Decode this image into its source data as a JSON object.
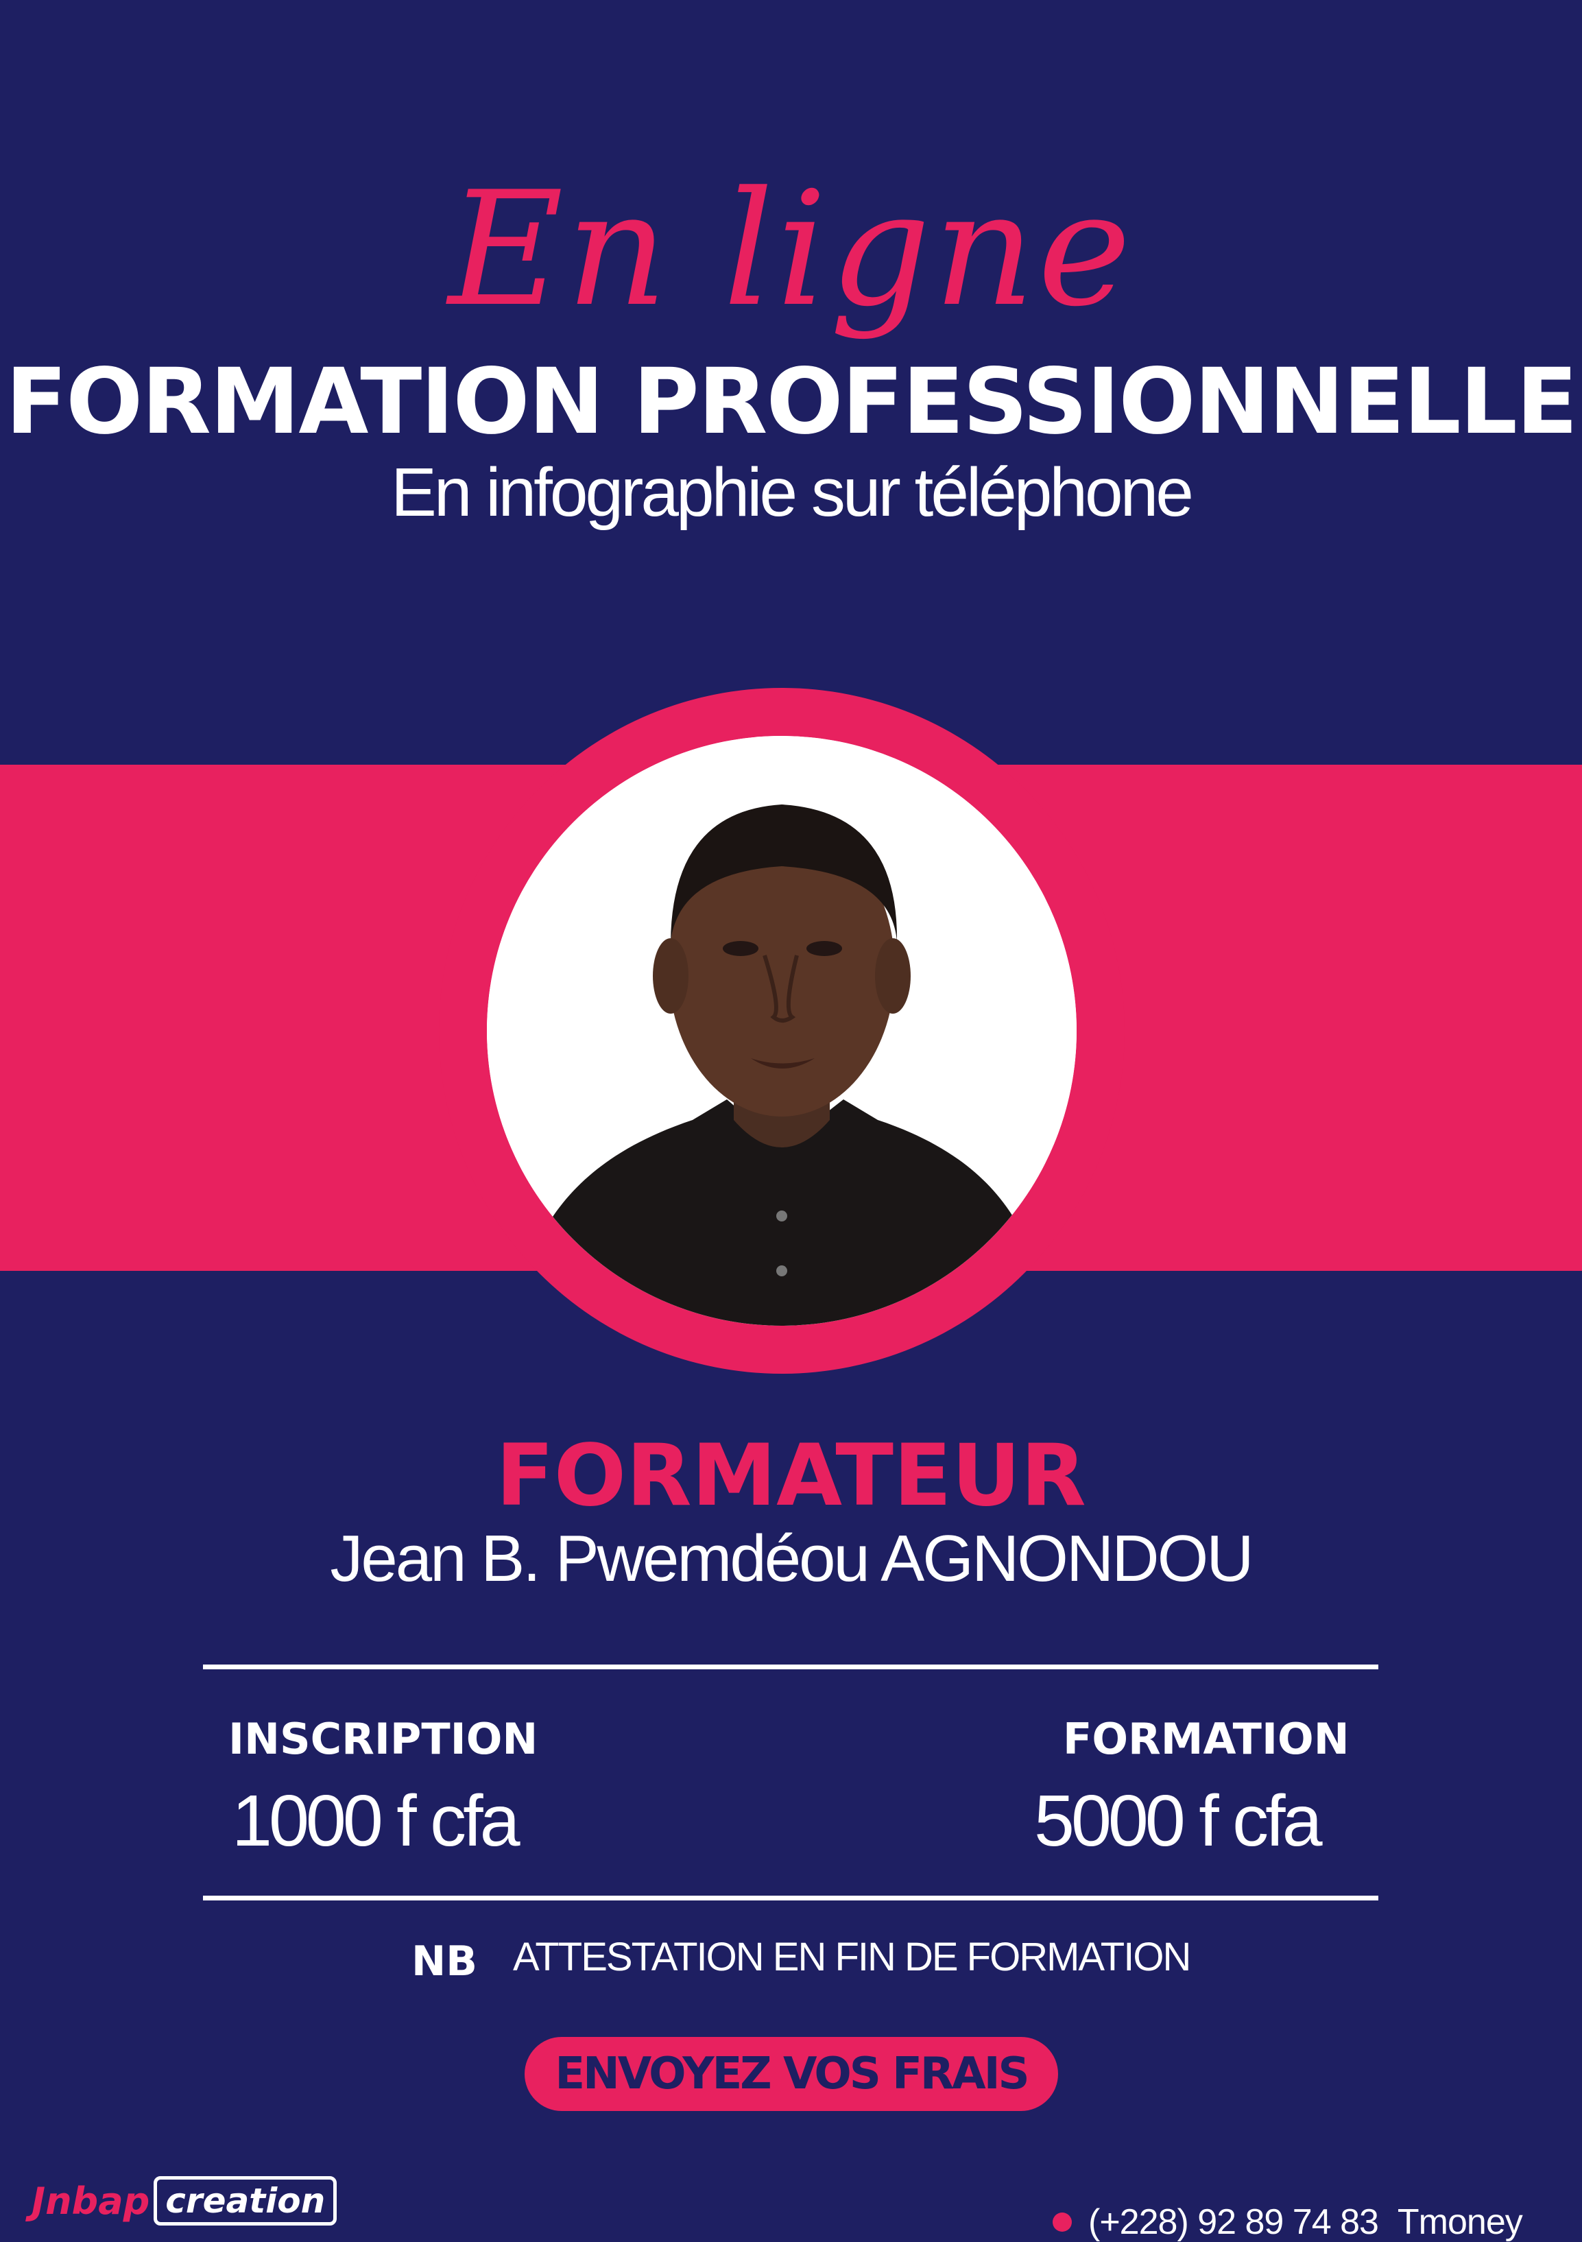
{
  "header": {
    "script_title": "En ligne",
    "main_title": "FORMATION PROFESSIONNELLE",
    "subtitle": "En infographie sur téléphone"
  },
  "trainer": {
    "role": "FORMATEUR",
    "name": "Jean B. Pwemdéou AGNONDOU"
  },
  "pricing": {
    "inscription": {
      "label": "INSCRIPTION",
      "value": "1000 f cfa"
    },
    "formation": {
      "label": "FORMATION",
      "value": "5000 f cfa"
    }
  },
  "note": {
    "label": "NB",
    "text": "ATTESTATION EN FIN DE FORMATION"
  },
  "cta": {
    "label": "ENVOYEZ VOS FRAIS"
  },
  "footer": {
    "logo_part1": "Jnbap",
    "logo_part2": "creation",
    "phone": "(+228) 92 89 74 83",
    "provider": "Tmoney"
  },
  "colors": {
    "background": "#1e1f62",
    "accent": "#e8215f",
    "text": "#ffffff"
  }
}
